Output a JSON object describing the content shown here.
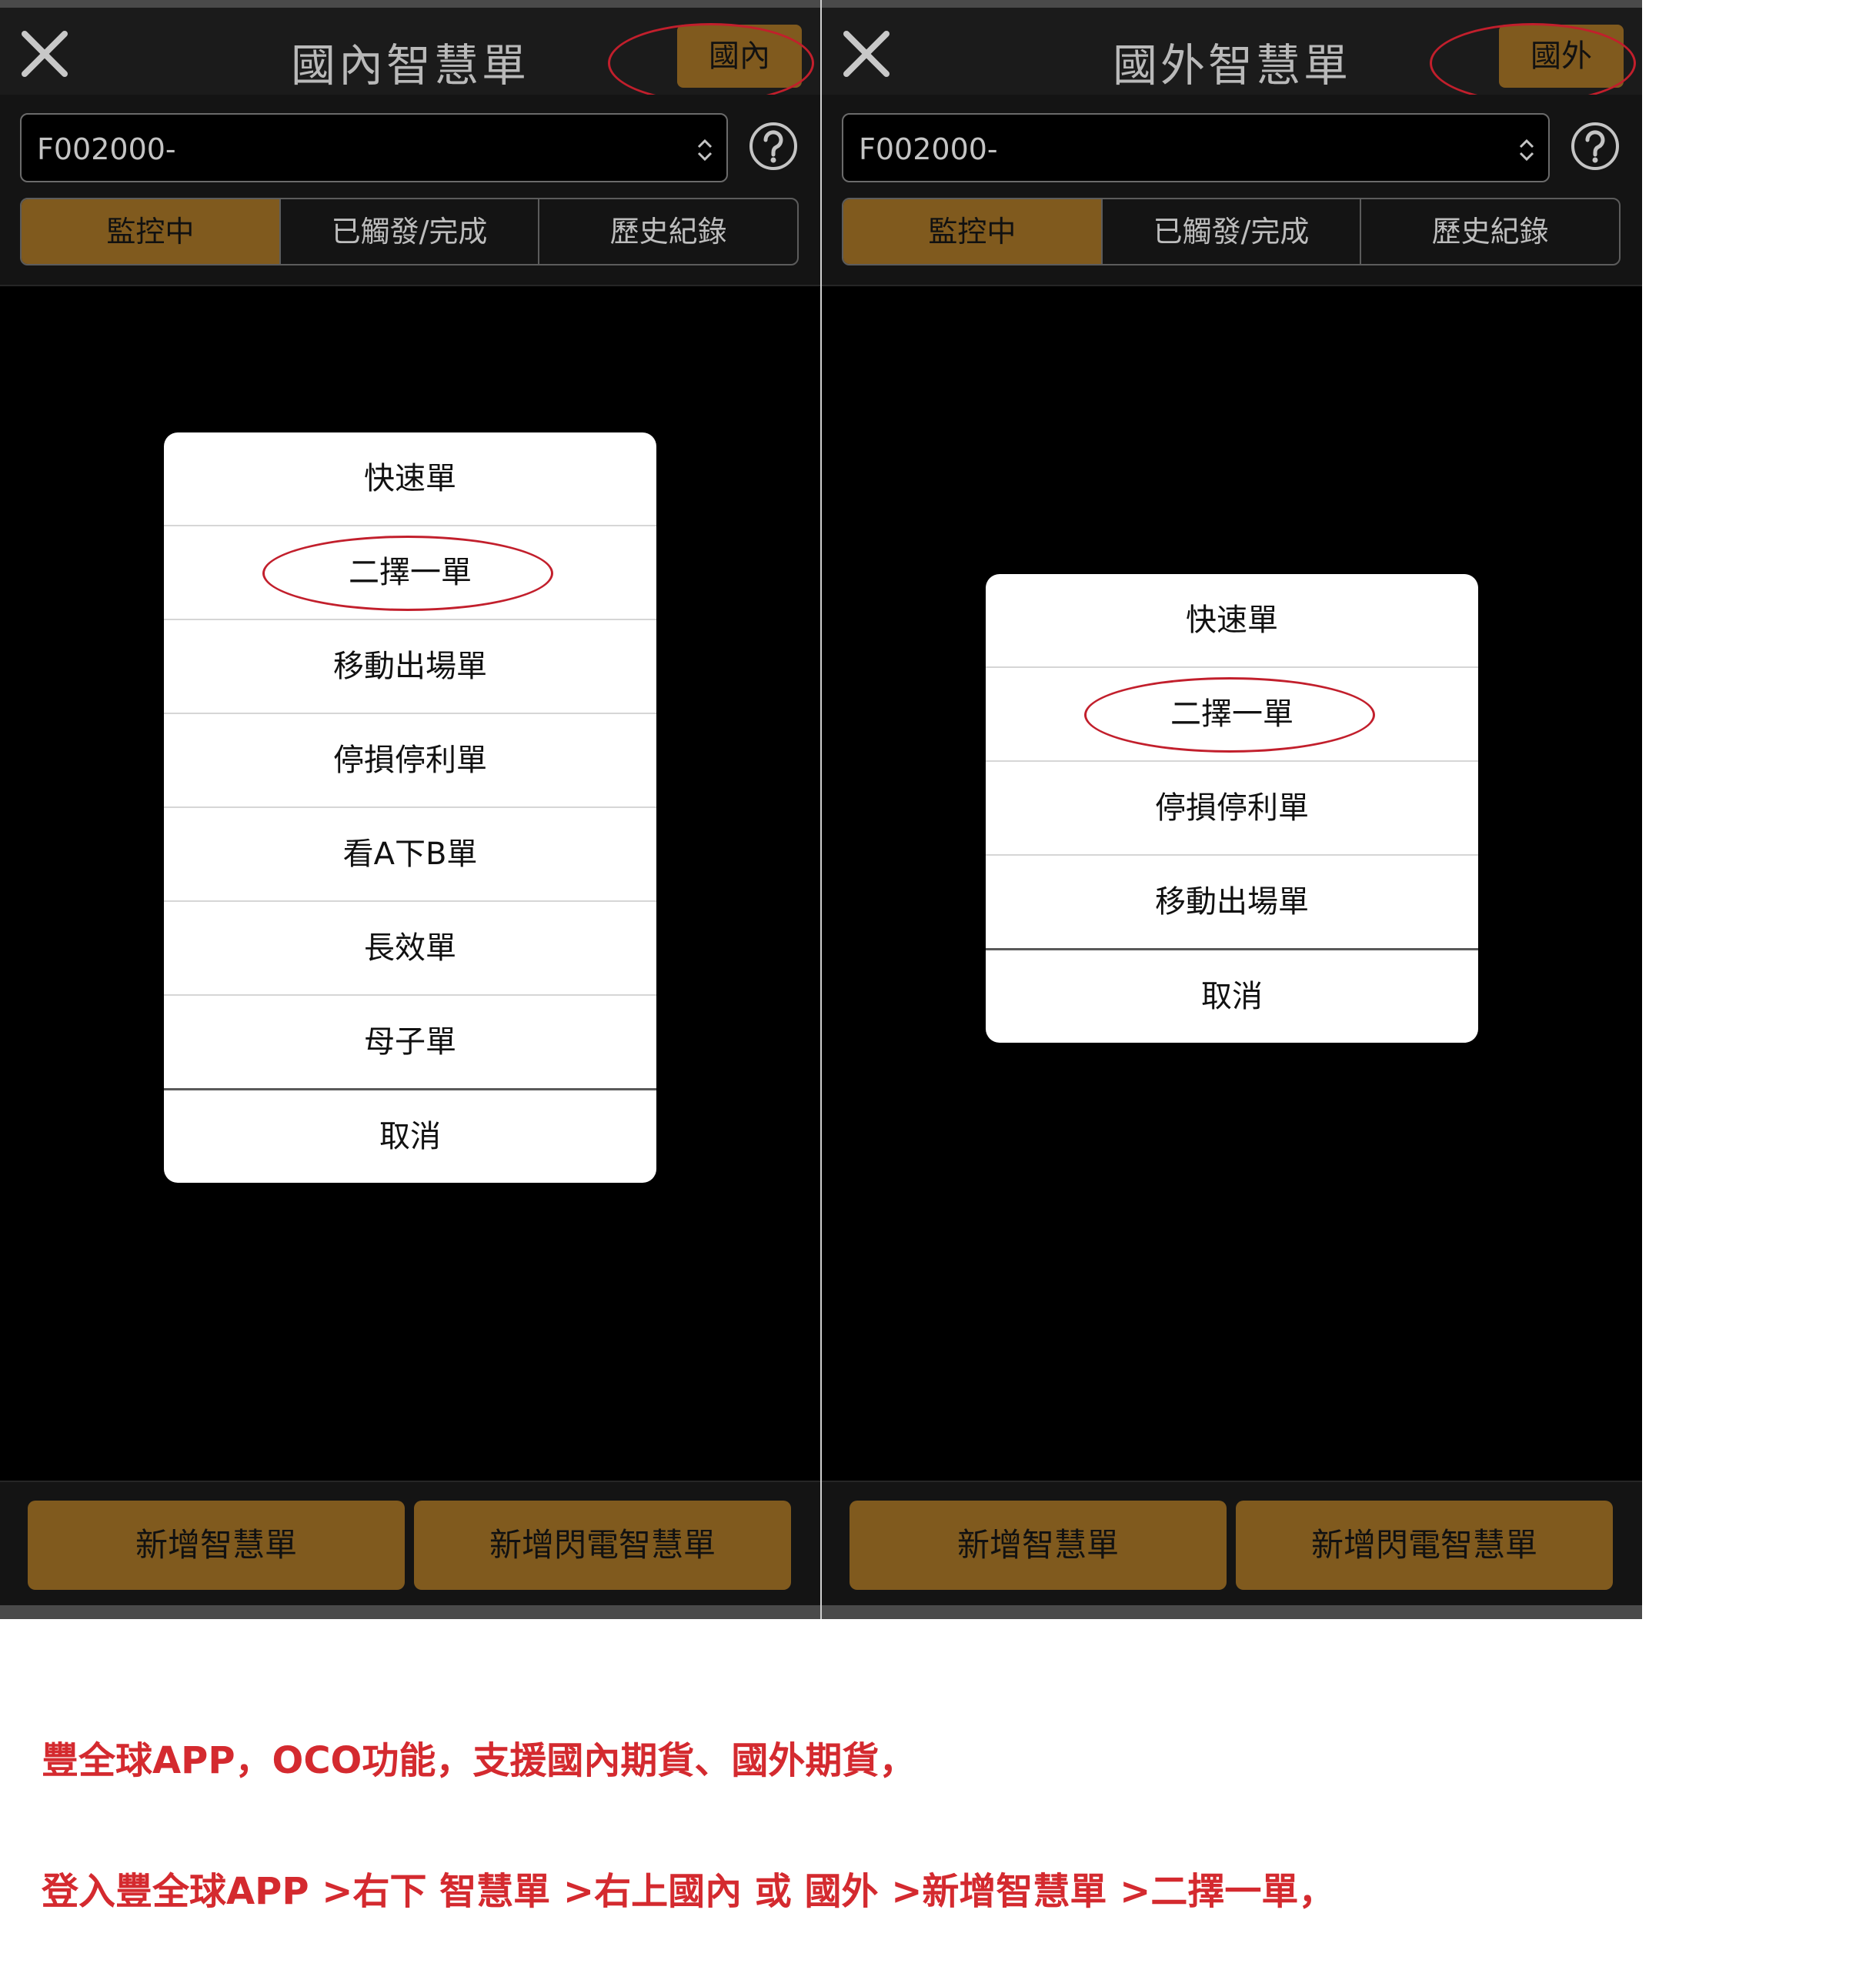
{
  "left_screen": {
    "title": "國內智慧單",
    "region_button": "國內",
    "account": "F002000-",
    "tabs": [
      {
        "label": "監控中"
      },
      {
        "label": "已觸發/完成"
      },
      {
        "label": "歷史紀錄"
      }
    ],
    "menu_items": [
      {
        "label": "快速單"
      },
      {
        "label": "二擇一單"
      },
      {
        "label": "移動出場單"
      },
      {
        "label": "停損停利單"
      },
      {
        "label": "看A下B單"
      },
      {
        "label": "長效單"
      },
      {
        "label": "母子單"
      }
    ],
    "cancel": "取消",
    "bottom_buttons": [
      {
        "label": "新增智慧單"
      },
      {
        "label": "新增閃電智慧單"
      }
    ]
  },
  "right_screen": {
    "title": "國外智慧單",
    "region_button": "國外",
    "account": "F002000-",
    "tabs": [
      {
        "label": "監控中"
      },
      {
        "label": "已觸發/完成"
      },
      {
        "label": "歷史紀錄"
      }
    ],
    "menu_items": [
      {
        "label": "快速單"
      },
      {
        "label": "二擇一單"
      },
      {
        "label": "停損停利單"
      },
      {
        "label": "移動出場單"
      }
    ],
    "cancel": "取消",
    "bottom_buttons": [
      {
        "label": "新增智慧單"
      },
      {
        "label": "新增閃電智慧單"
      }
    ]
  },
  "captions": {
    "line1": "豐全球APP，OCO功能，支援國內期貨、國外期貨，",
    "line2": "登入豐全球APP >右下 智慧單 >右上國內 或 國外 >新增智慧單 >二擇一單，"
  },
  "colors": {
    "accent_gold": "#805a1e",
    "highlight_red": "#c21f2c",
    "caption_red": "#d42a2f"
  },
  "icons": {
    "close": "close-icon",
    "help": "help-icon",
    "dropdown": "updown-chevron-icon"
  }
}
